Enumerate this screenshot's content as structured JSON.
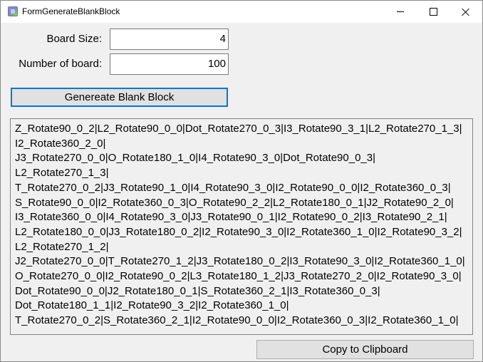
{
  "window": {
    "title": "FormGenerateBlankBlock"
  },
  "form": {
    "board_size_label": "Board Size:",
    "board_size_value": "4",
    "board_count_label": "Number of board:",
    "board_count_value": "100",
    "generate_button": "Genereate Blank Block",
    "copy_button": "Copy to Clipboard"
  },
  "output": {
    "lines": [
      "Z_Rotate90_0_2|L2_Rotate90_0_0|Dot_Rotate270_0_3|I3_Rotate90_3_1|L2_Rotate270_1_3|",
      "I2_Rotate360_2_0|",
      "J3_Rotate270_0_0|O_Rotate180_1_0|I4_Rotate90_3_0|Dot_Rotate90_0_3|",
      "L2_Rotate270_1_3|",
      "T_Rotate270_0_2|J3_Rotate90_1_0|I4_Rotate90_3_0|I2_Rotate90_0_0|I2_Rotate360_0_3|",
      "S_Rotate90_0_0|I2_Rotate360_0_3|O_Rotate90_2_2|L2_Rotate180_0_1|J2_Rotate90_2_0|",
      "I3_Rotate360_0_0|I4_Rotate90_3_0|J3_Rotate90_0_1|I2_Rotate90_0_2|I3_Rotate90_2_1|",
      "L2_Rotate180_0_0|J3_Rotate180_0_2|I2_Rotate90_3_0|I2_Rotate360_1_0|I2_Rotate90_3_2|",
      "L2_Rotate270_1_2|",
      "J2_Rotate270_0_0|T_Rotate270_1_2|J3_Rotate180_0_2|I3_Rotate90_3_0|I2_Rotate360_1_0|",
      "O_Rotate270_0_0|I2_Rotate90_0_2|L3_Rotate180_1_2|J3_Rotate270_2_0|I2_Rotate90_3_0|",
      "Dot_Rotate90_0_0|J2_Rotate180_0_1|S_Rotate360_2_1|I3_Rotate360_0_3|",
      "Dot_Rotate180_1_1|I2_Rotate90_3_2|I2_Rotate360_1_0|",
      "T_Rotate270_0_2|S_Rotate360_2_1|I2_Rotate90_0_0|I2_Rotate360_0_3|I2_Rotate360_1_0|"
    ]
  }
}
